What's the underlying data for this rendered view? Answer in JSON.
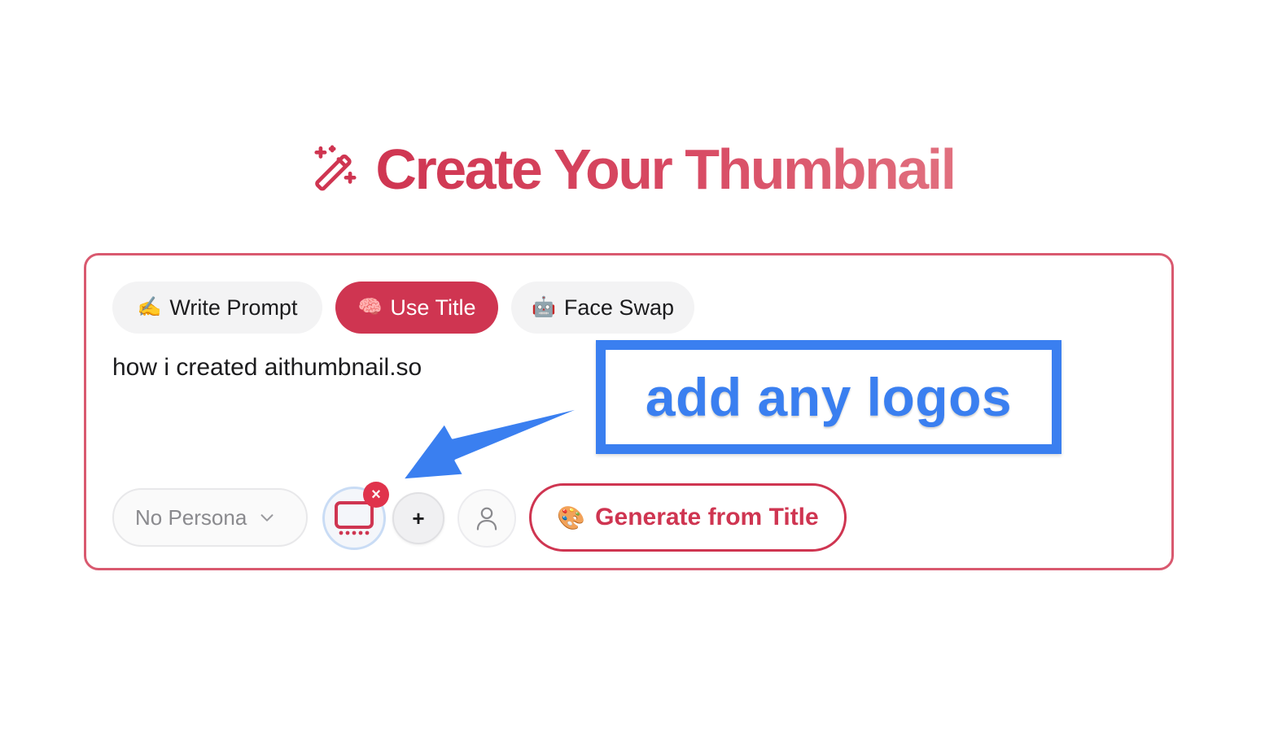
{
  "header": {
    "title": "Create Your Thumbnail",
    "icon": "magic-wand-icon",
    "gradient_colors": [
      "#cf3551",
      "#e1707f"
    ]
  },
  "tabs": [
    {
      "emoji": "✍️",
      "label": "Write Prompt",
      "active": false
    },
    {
      "emoji": "🧠",
      "label": "Use Title",
      "active": true
    },
    {
      "emoji": "🤖",
      "label": "Face Swap",
      "active": false
    }
  ],
  "prompt": {
    "value": "how i created aithumbnail.so"
  },
  "controls": {
    "persona_select": {
      "value": "No Persona",
      "icon": "chevron-down-icon"
    },
    "logo": {
      "icon": "tv-logo-icon",
      "remove_label": "×"
    },
    "add_logo_label": "+",
    "face_icon": "person-icon",
    "generate": {
      "emoji": "🎨",
      "label": "Generate from Title"
    }
  },
  "annotation": {
    "text": "add any logos",
    "color": "#3a7ff0"
  },
  "colors": {
    "accent": "#cf3551",
    "card_border": "#d9596f",
    "annotation": "#3a7ff0"
  }
}
